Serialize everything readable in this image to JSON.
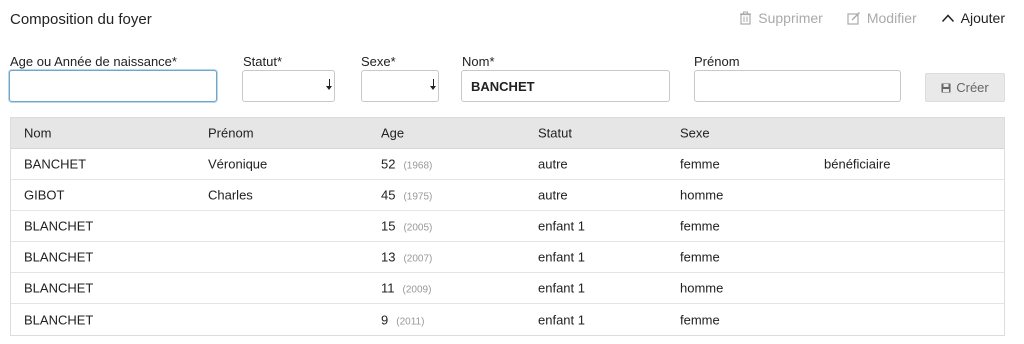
{
  "header": {
    "title": "Composition du foyer",
    "delete_label": "Supprimer",
    "edit_label": "Modifier",
    "add_label": "Ajouter"
  },
  "form": {
    "age_label": "Age ou Année de naissance*",
    "age_value": "",
    "statut_label": "Statut*",
    "sexe_label": "Sexe*",
    "nom_label": "Nom*",
    "nom_value": "BANCHET",
    "prenom_label": "Prénom",
    "prenom_value": "",
    "create_label": "Créer"
  },
  "table": {
    "headers": [
      "Nom",
      "Prénom",
      "Age",
      "Statut",
      "Sexe",
      ""
    ],
    "rows": [
      {
        "nom": "BANCHET",
        "prenom": "Véronique",
        "age": "52",
        "year": "(1968)",
        "statut": "autre",
        "sexe": "femme",
        "role": "bénéficiaire"
      },
      {
        "nom": "GIBOT",
        "prenom": "Charles",
        "age": "45",
        "year": "(1975)",
        "statut": "autre",
        "sexe": "homme",
        "role": ""
      },
      {
        "nom": "BLANCHET",
        "prenom": "",
        "age": "15",
        "year": "(2005)",
        "statut": "enfant 1",
        "sexe": "femme",
        "role": ""
      },
      {
        "nom": "BLANCHET",
        "prenom": "",
        "age": "13",
        "year": "(2007)",
        "statut": "enfant 1",
        "sexe": "femme",
        "role": ""
      },
      {
        "nom": "BLANCHET",
        "prenom": "",
        "age": "11",
        "year": "(2009)",
        "statut": "enfant 1",
        "sexe": "homme",
        "role": ""
      },
      {
        "nom": "BLANCHET",
        "prenom": "",
        "age": "9",
        "year": "(2011)",
        "statut": "enfant 1",
        "sexe": "femme",
        "role": ""
      }
    ]
  },
  "icons": {
    "delete": "trash-icon",
    "edit": "edit-icon",
    "add": "chevron-up-icon",
    "create": "save-icon"
  }
}
